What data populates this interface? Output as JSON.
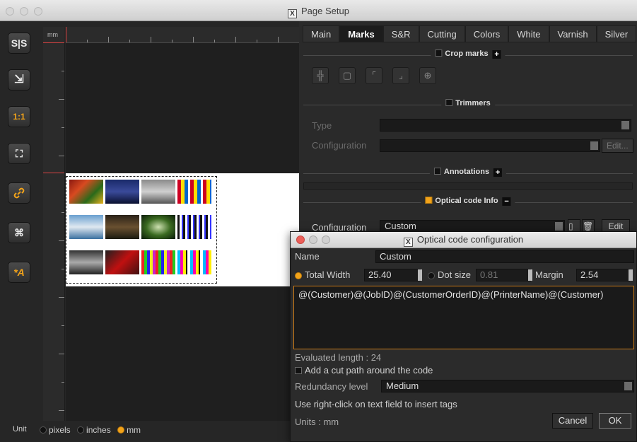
{
  "window": {
    "title": "Page Setup"
  },
  "toolbar": {
    "buttons": [
      {
        "name": "split-view-button",
        "glyph": "S|S"
      },
      {
        "name": "export-button",
        "glyph": "⇲"
      },
      {
        "name": "actual-size-button",
        "glyph": "1:1"
      },
      {
        "name": "fit-page-button",
        "glyph": "⛶"
      },
      {
        "name": "link-button",
        "glyph": "🔗"
      },
      {
        "name": "fit-selection-button",
        "glyph": "⌘"
      },
      {
        "name": "auto-button",
        "glyph": "*A"
      }
    ]
  },
  "canvas": {
    "ruler_unit": "mm"
  },
  "unit_bar": {
    "label": "Unit",
    "options": [
      "pixels",
      "inches",
      "mm"
    ],
    "selected": "mm"
  },
  "tabs": [
    "Main",
    "Marks",
    "S&R",
    "Cutting",
    "Colors",
    "White",
    "Varnish",
    "Silver"
  ],
  "active_tab": "Marks",
  "crop_marks": {
    "title": "Crop marks",
    "icons": [
      "crop-corner-icon",
      "crop-box-icon",
      "crop-inner-icon",
      "crop-outer-icon",
      "registration-target-icon"
    ]
  },
  "trimmers": {
    "title": "Trimmers",
    "type_label": "Type",
    "config_label": "Configuration",
    "edit_label": "Edit..."
  },
  "annotations": {
    "title": "Annotations"
  },
  "optical": {
    "title": "Optical code Info",
    "config_label": "Configuration",
    "config_value": "Custom",
    "edit_label": "Edit"
  },
  "dialog": {
    "title": "Optical code configuration",
    "name_label": "Name",
    "name_value": "Custom",
    "total_width_label": "Total Width",
    "total_width_value": "25.40",
    "dot_size_label": "Dot size",
    "dot_size_value": "0.81",
    "margin_label": "Margin",
    "margin_value": "2.54",
    "tags_text": "@(Customer)@(JobID)@(CustomerOrderID)@(PrinterName)@(Customer)",
    "evaluated_label": "Evaluated length",
    "evaluated_value": "24",
    "cut_path_label": "Add a cut path around the code",
    "redundancy_label": "Redundancy level",
    "redundancy_value": "Medium",
    "hint": "Use right-click on text field to insert tags",
    "units_label": "Units",
    "units_value": "mm",
    "cancel_label": "Cancel",
    "ok_label": "OK"
  },
  "colors": {
    "accent": "#f2a31a",
    "panel": "#2a2a2a",
    "tag_border": "#c97a16"
  }
}
